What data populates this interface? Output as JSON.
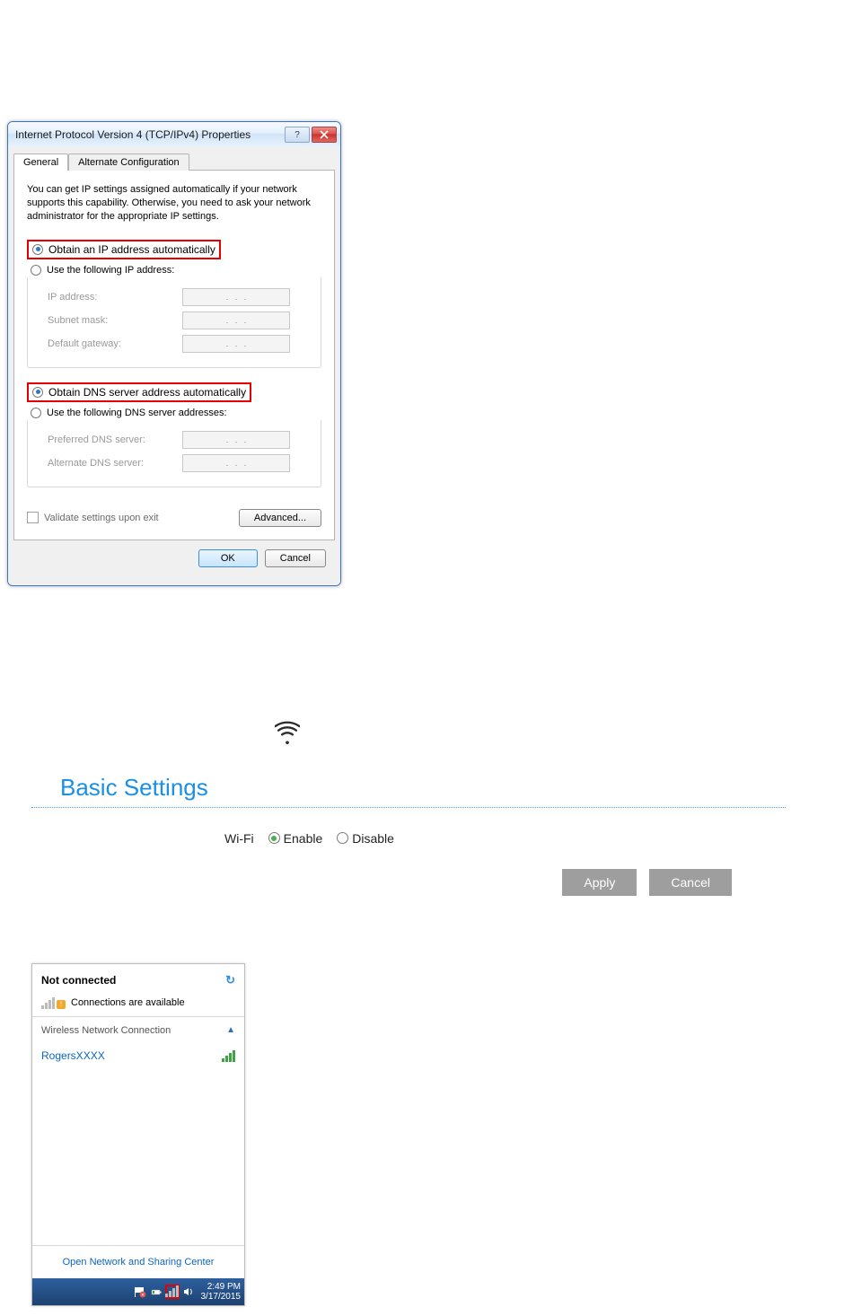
{
  "dialog": {
    "title": "Internet Protocol Version 4 (TCP/IPv4) Properties",
    "tabs": {
      "general": "General",
      "alternate": "Alternate Configuration"
    },
    "info": "You can get IP settings assigned automatically if your network supports this capability. Otherwise, you need to ask your network administrator for the appropriate IP settings.",
    "ip": {
      "auto": "Obtain an IP address automatically",
      "manual": "Use the following IP address:",
      "fields": {
        "ip": "IP address:",
        "mask": "Subnet mask:",
        "gw": "Default gateway:"
      }
    },
    "dns": {
      "auto": "Obtain DNS server address automatically",
      "manual": "Use the following DNS server addresses:",
      "fields": {
        "pref": "Preferred DNS server:",
        "alt": "Alternate DNS server:"
      }
    },
    "validate": "Validate settings upon exit",
    "advanced": "Advanced...",
    "ok": "OK",
    "cancel": "Cancel"
  },
  "basic": {
    "title": "Basic Settings",
    "label": "Wi-Fi",
    "enable": "Enable",
    "disable": "Disable",
    "apply": "Apply",
    "cancel": "Cancel"
  },
  "wifi_popup": {
    "status": "Not connected",
    "avail": "Connections are available",
    "section": "Wireless Network Connection",
    "network": "RogersXXXX",
    "link": "Open Network and Sharing Center",
    "time": "2:49 PM",
    "date": "3/17/2015"
  }
}
